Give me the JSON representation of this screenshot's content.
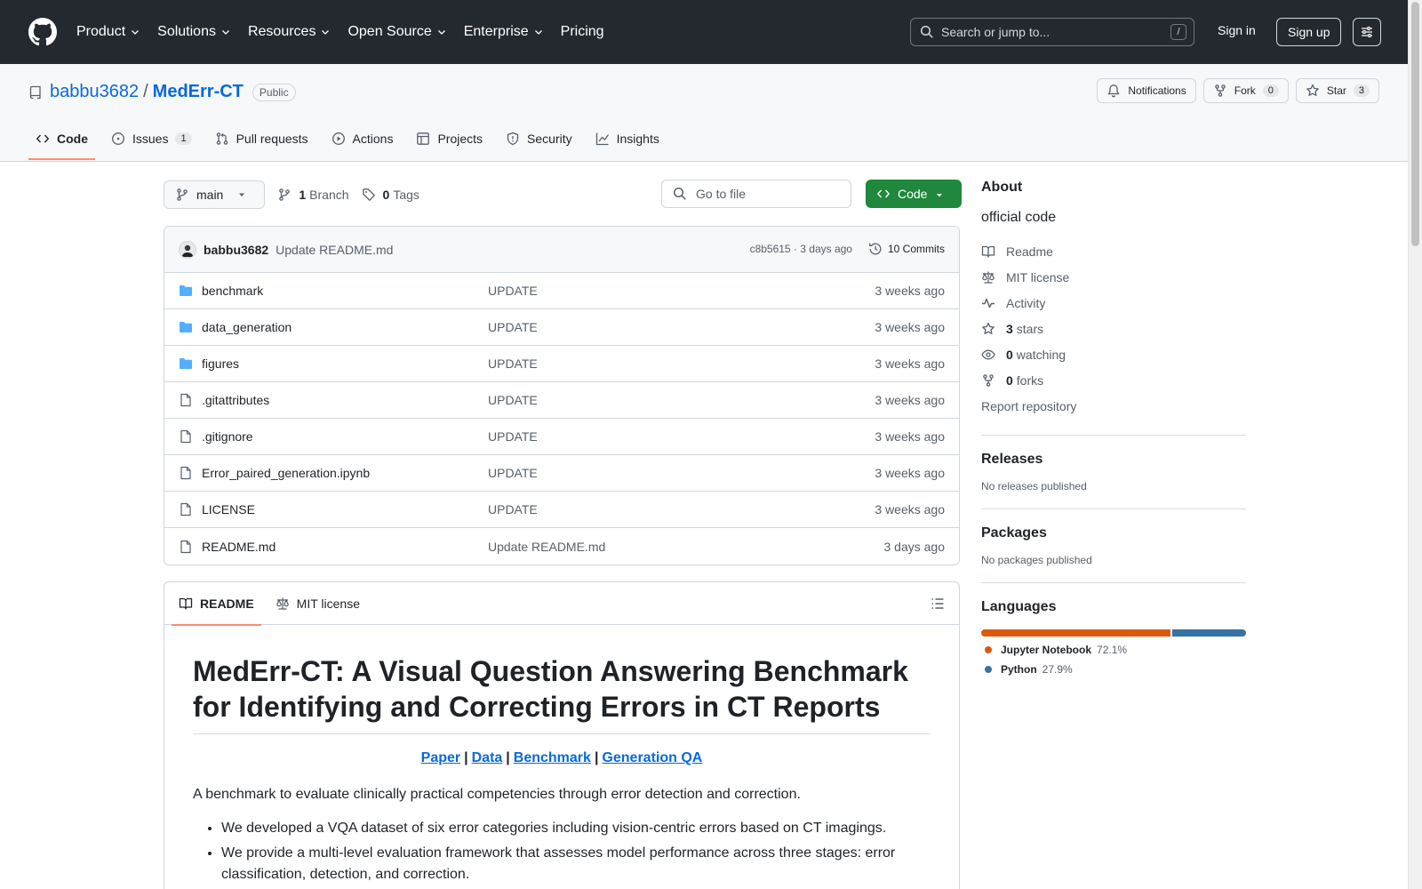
{
  "header": {
    "nav": [
      "Product",
      "Solutions",
      "Resources",
      "Open Source",
      "Enterprise",
      "Pricing"
    ],
    "search_placeholder": "Search or jump to...",
    "search_shortcut": "/",
    "signin": "Sign in",
    "signup": "Sign up"
  },
  "repo": {
    "owner": "babbu3682",
    "separator": "/",
    "name": "MedErr-CT",
    "visibility": "Public",
    "notifications": "Notifications",
    "fork_label": "Fork",
    "fork_count": "0",
    "star_label": "Star",
    "star_count": "3"
  },
  "tabs": [
    {
      "label": "Code"
    },
    {
      "label": "Issues",
      "count": "1"
    },
    {
      "label": "Pull requests"
    },
    {
      "label": "Actions"
    },
    {
      "label": "Projects"
    },
    {
      "label": "Security"
    },
    {
      "label": "Insights"
    }
  ],
  "toolbar": {
    "branch": "main",
    "branch_count": "1",
    "branch_label": "Branch",
    "tag_count": "0",
    "tag_label": "Tags",
    "goto_placeholder": "Go to file",
    "code_button": "Code"
  },
  "commit": {
    "author": "babbu3682",
    "message": "Update README.md",
    "hash_time": "c8b5615 · 3 days ago",
    "commits": "10 Commits"
  },
  "files": [
    {
      "type": "folder",
      "name": "benchmark",
      "message": "UPDATE",
      "time": "3 weeks ago"
    },
    {
      "type": "folder",
      "name": "data_generation",
      "message": "UPDATE",
      "time": "3 weeks ago"
    },
    {
      "type": "folder",
      "name": "figures",
      "message": "UPDATE",
      "time": "3 weeks ago"
    },
    {
      "type": "file",
      "name": ".gitattributes",
      "message": "UPDATE",
      "time": "3 weeks ago"
    },
    {
      "type": "file",
      "name": ".gitignore",
      "message": "UPDATE",
      "time": "3 weeks ago"
    },
    {
      "type": "file",
      "name": "Error_paired_generation.ipynb",
      "message": "UPDATE",
      "time": "3 weeks ago"
    },
    {
      "type": "file",
      "name": "LICENSE",
      "message": "UPDATE",
      "time": "3 weeks ago"
    },
    {
      "type": "file",
      "name": "README.md",
      "message": "Update README.md",
      "time": "3 days ago"
    }
  ],
  "readme": {
    "tab_readme": "README",
    "tab_license": "MIT license",
    "title": "MedErr-CT: A Visual Question Answering Benchmark for Identifying and Correcting Errors in CT Reports",
    "links": [
      "Paper",
      "Data",
      "Benchmark",
      "Generation QA"
    ],
    "link_separator": "|",
    "intro": "A benchmark to evaluate clinically practical competencies through error detection and correction.",
    "bullets": [
      "We developed a VQA dataset of six error categories including vision-centric errors based on CT imagings.",
      "We provide a multi-level evaluation framework that assesses model performance across three stages: error classification, detection, and correction."
    ]
  },
  "sidebar": {
    "about_title": "About",
    "description": "official code",
    "readme": "Readme",
    "license": "MIT license",
    "activity": "Activity",
    "stars_count": "3",
    "stars_label": "stars",
    "watching_count": "0",
    "watching_label": "watching",
    "forks_count": "0",
    "forks_label": "forks",
    "report": "Report repository",
    "releases_title": "Releases",
    "releases_text": "No releases published",
    "packages_title": "Packages",
    "packages_text": "No packages published",
    "languages_title": "Languages",
    "languages": [
      {
        "name": "Jupyter Notebook",
        "percent": "72.1%",
        "value": 72.1,
        "color": "#DA5B0B"
      },
      {
        "name": "Python",
        "percent": "27.9%",
        "value": 27.9,
        "color": "#3572A5"
      }
    ]
  },
  "colors": {
    "header_bg": "#24292f",
    "link": "#0969da",
    "primary_button": "#1f883d",
    "tab_underline": "#fd8c73",
    "folder": "#54aeff"
  }
}
